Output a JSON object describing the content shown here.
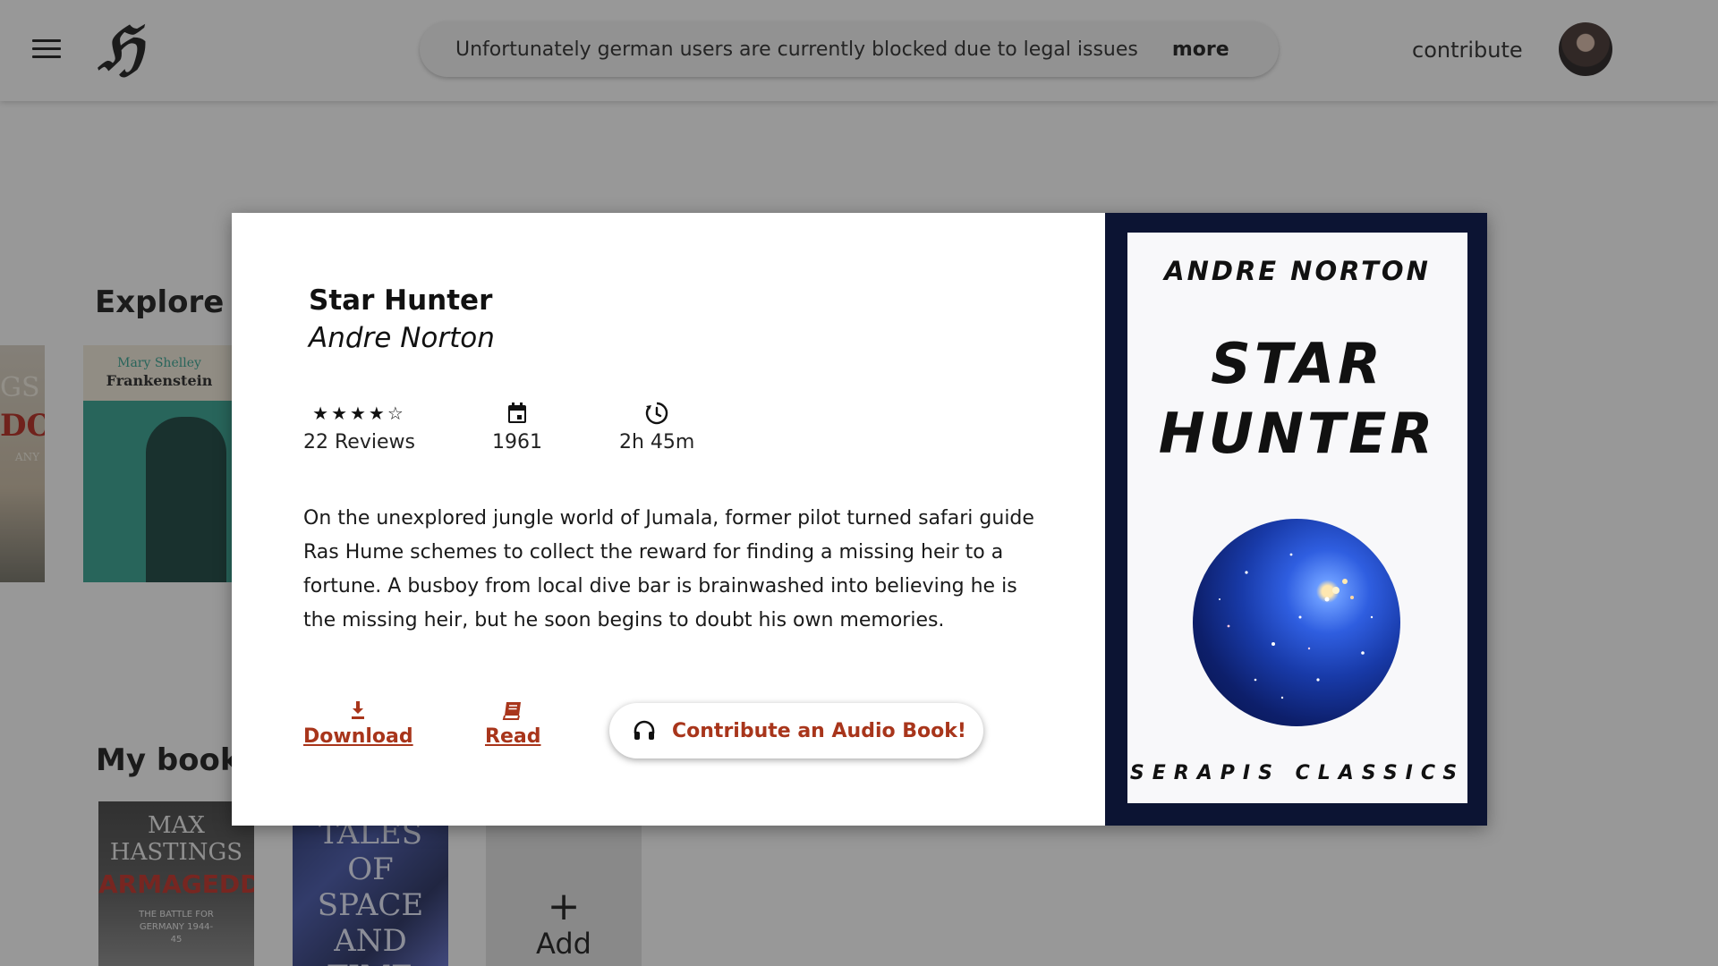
{
  "header": {
    "logo": "ℌ",
    "banner_text": "Unfortunately german users are currently blocked due to legal issues",
    "banner_more": "more",
    "contribute": "contribute"
  },
  "explore": {
    "title": "Explore",
    "books": [
      {
        "cover_lines": [
          "GS",
          "DON",
          "ANY"
        ]
      },
      {
        "cover_author": "Mary Shelley",
        "cover_title": "Frankenstein"
      }
    ]
  },
  "my_books": {
    "title": "My bookl",
    "books": [
      {
        "cover_author": "MAX HASTINGS",
        "cover_title": "ARMAGEDDON",
        "cover_subtitle": "THE BATTLE FOR GERMANY 1944-45"
      },
      {
        "cover_title": "TALES OF SPACE AND TIME"
      }
    ],
    "add_label": "Add"
  },
  "modal": {
    "title": "Star Hunter",
    "author": "Andre Norton",
    "rating": 4,
    "rating_max": 5,
    "reviews": "22 Reviews",
    "year": "1961",
    "duration": "2h 45m",
    "description": "On the unexplored jungle world of Jumala, former pilot turned safari guide Ras Hume schemes to collect the reward for finding a missing heir to a fortune. A busboy from local dive bar is brainwashed into believing he is the missing heir, but he soon begins to doubt his own memories.",
    "actions": {
      "download": "Download",
      "read": "Read",
      "audio": "Contribute an Audio Book!"
    },
    "cover": {
      "author": "ANDRE NORTON",
      "title_line1": "STAR",
      "title_line2": "HUNTER",
      "publisher": "SERAPIS CLASSICS"
    }
  },
  "colors": {
    "accent": "#a8351b",
    "cover_frame": "#0c1433",
    "overlay": "rgba(40,40,40,0.48)"
  },
  "icons": {
    "menu": "hamburger-icon",
    "calendar": "calendar-icon",
    "duration": "history-icon",
    "download": "download-icon",
    "read": "book-icon",
    "audio": "headphones-icon"
  }
}
